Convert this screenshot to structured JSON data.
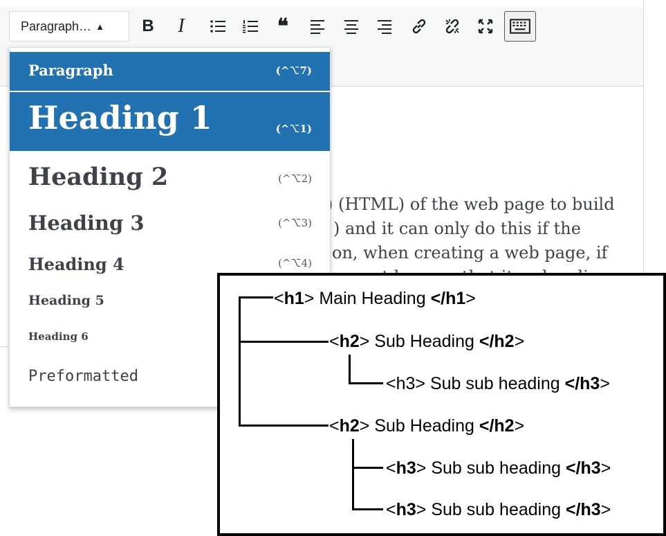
{
  "toolbar": {
    "format_select_value": "Paragraph…",
    "caret_glyph": "▲",
    "bold_glyph": "B",
    "italic_glyph": "I",
    "quote_glyph": "❝",
    "buttons": [
      "bold",
      "italic",
      "bulleted-list",
      "numbered-list",
      "blockquote",
      "align-left",
      "align-center",
      "align-right",
      "insert-link",
      "remove-link",
      "fullscreen",
      "toolbar-toggle"
    ]
  },
  "content": {
    "lines": [
      ") (HTML) of the web page to build",
      ") and it can only do this if the",
      "on, when creating a web page, if",
      "a must be sure that its a heading"
    ]
  },
  "dropdown": {
    "items": [
      {
        "label": "Paragraph",
        "shortcut": "(^⌥7)"
      },
      {
        "label": "Heading 1",
        "shortcut": "(^⌥1)"
      },
      {
        "label": "Heading 2",
        "shortcut": "(^⌥2)"
      },
      {
        "label": "Heading 3",
        "shortcut": "(^⌥3)"
      },
      {
        "label": "Heading 4",
        "shortcut": "(^⌥4)"
      },
      {
        "label": "Heading 5",
        "shortcut": ""
      },
      {
        "label": "Heading 6",
        "shortcut": ""
      },
      {
        "label": "Preformatted",
        "shortcut": ""
      }
    ]
  },
  "hierarchy": {
    "lt": "<",
    "gt": ">",
    "lt_slash": "</",
    "nodes": [
      {
        "tag": "h1",
        "text": " Main Heading ",
        "open_bold": true
      },
      {
        "tag": "h2",
        "text": " Sub Heading ",
        "open_bold": true
      },
      {
        "tag": "h3",
        "text": " Sub sub heading ",
        "open_bold": false
      },
      {
        "tag": "h2",
        "text": " Sub Heading ",
        "open_bold": true
      },
      {
        "tag": "h3",
        "text": " Sub sub heading ",
        "open_bold": true
      },
      {
        "tag": "h3",
        "text": " Sub sub heading ",
        "open_bold": true
      }
    ]
  },
  "colors": {
    "accent": "#2271b1",
    "toolbar_bg": "#f6f7f7",
    "text": "#1d2327"
  }
}
